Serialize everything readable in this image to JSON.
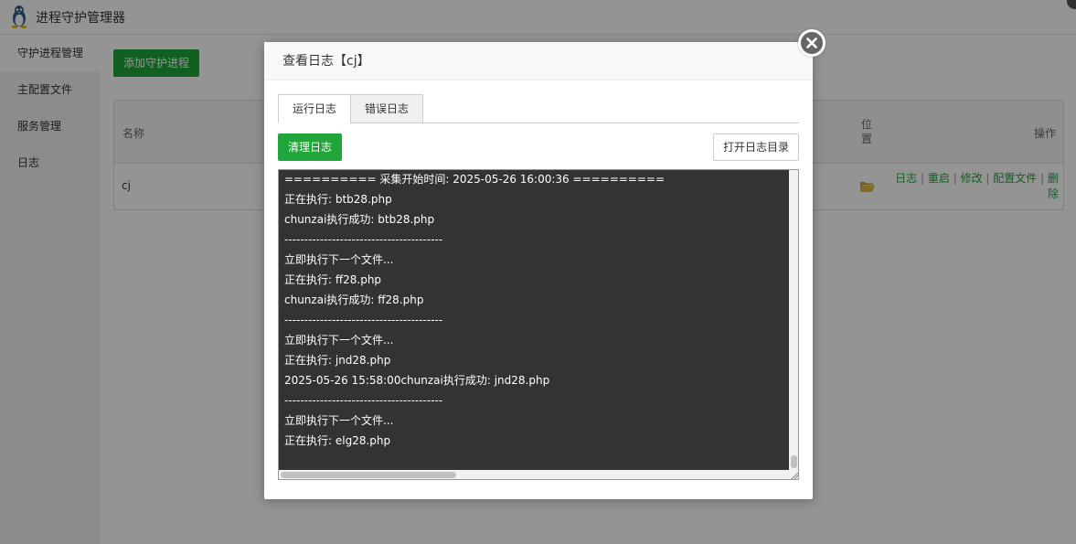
{
  "app": {
    "title": "进程守护管理器"
  },
  "sidebar": {
    "items": [
      {
        "label": "守护进程管理"
      },
      {
        "label": "主配置文件"
      },
      {
        "label": "服务管理"
      },
      {
        "label": "日志"
      }
    ]
  },
  "main": {
    "add_button": "添加守护进程",
    "table": {
      "headers": {
        "name": "名称",
        "location": "位置",
        "actions": "操作"
      },
      "rows": [
        {
          "name": "cj",
          "actions": [
            "日志",
            "重启",
            "修改",
            "配置文件",
            "删除"
          ]
        }
      ]
    }
  },
  "modal": {
    "title": "查看日志【cj】",
    "tabs": [
      {
        "label": "运行日志",
        "active": true
      },
      {
        "label": "错误日志",
        "active": false
      }
    ],
    "clear_button": "清理日志",
    "open_dir_button": "打开日志目录",
    "log_lines": [
      "========== 采集开始时间: 2025-05-26 16:00:36 ==========",
      "正在执行: btb28.php",
      "chunzai执行成功: btb28.php",
      "----------------------------------------",
      "立即执行下一个文件...",
      "正在执行: ff28.php",
      "chunzai执行成功: ff28.php",
      "----------------------------------------",
      "立即执行下一个文件...",
      "正在执行: jnd28.php",
      "2025-05-26 15:58:00chunzai执行成功: jnd28.php",
      "----------------------------------------",
      "立即执行下一个文件...",
      "正在执行: elg28.php"
    ]
  },
  "colors": {
    "primary_green": "#20a53a",
    "log_background": "#333333",
    "folder": "#e4b93f"
  },
  "icons": [
    "tux-icon",
    "folder-open-icon",
    "close-icon"
  ]
}
